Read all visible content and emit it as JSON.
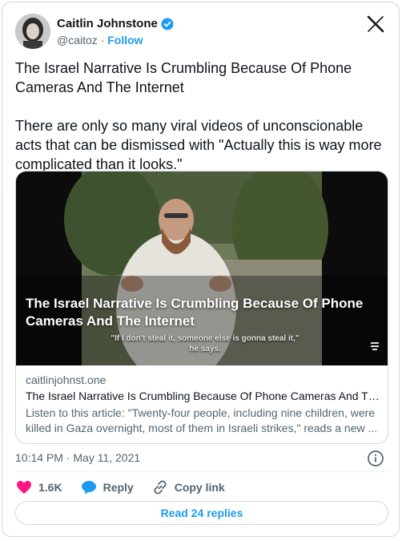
{
  "author": {
    "name": "Caitlin Johnstone",
    "handle": "@caitoz",
    "separator": "·",
    "follow_label": "Follow",
    "verified": true
  },
  "tweet": {
    "paragraphs": [
      "The Israel Narrative Is Crumbling Because Of Phone Cameras And The Internet",
      "There are only so many viral videos of unconscionable acts that can be dismissed with \"Actually this is way more complicated than it looks.\""
    ]
  },
  "card": {
    "media_title": "The Israel Narrative Is Crumbling Because Of Phone Cameras And The Internet",
    "media_caption": "\"If I don't steal it, someone else is gonna steal it,\" he says.",
    "domain": "caitlinjohnst.one",
    "title": "The Israel Narrative Is Crumbling Because Of Phone Cameras And Th...",
    "description": "Listen to this article: \"Twenty-four people, including nine children, were killed in Gaza overnight, most of them in Israeli strikes,\" reads a new ..."
  },
  "meta": {
    "timestamp": "10:14 PM · May 11, 2021"
  },
  "actions": {
    "likes": "1.6K",
    "reply_label": "Reply",
    "copy_link_label": "Copy link"
  },
  "replies_button": "Read 24 replies",
  "colors": {
    "accent": "#1d9bf0",
    "like": "#f91880",
    "text_primary": "#0f1419",
    "text_secondary": "#536471",
    "border": "#cfd9de"
  },
  "icons": {
    "verified": "verified-badge-icon",
    "brand": "x-logo-icon",
    "info": "info-icon",
    "like": "heart-icon",
    "reply": "speech-bubble-icon",
    "copy_link": "link-icon",
    "menu": "menu-glyph-icon"
  }
}
